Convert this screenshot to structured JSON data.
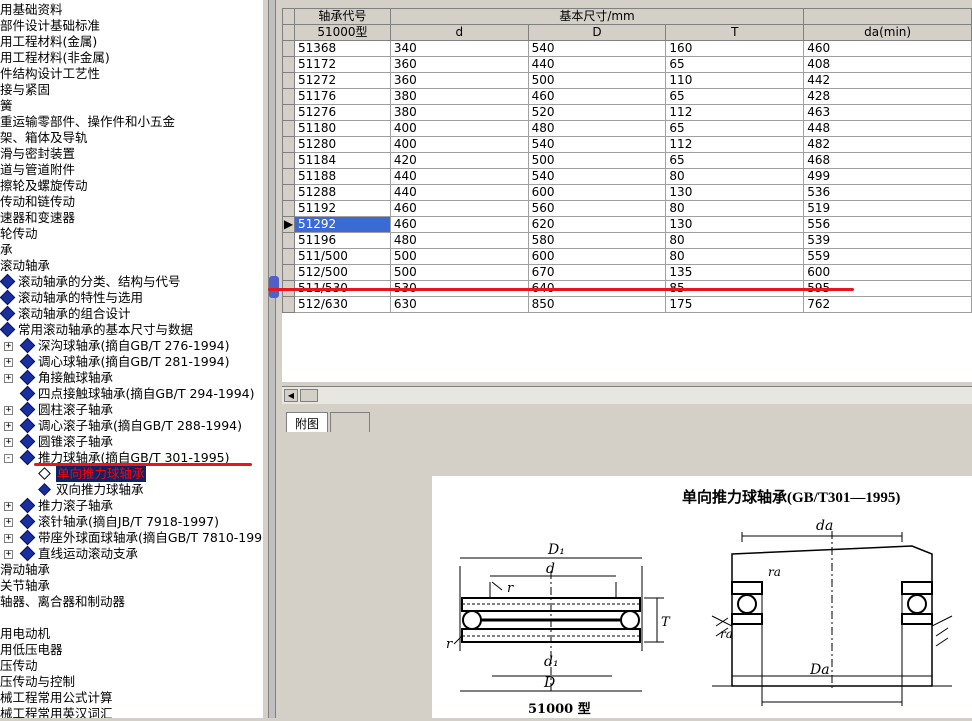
{
  "tree": {
    "items": [
      {
        "label": "用基础资料",
        "x": 0,
        "icon": false
      },
      {
        "label": "部件设计基础标准",
        "x": 0,
        "icon": false
      },
      {
        "label": "用工程材料(金属)",
        "x": 0,
        "icon": false
      },
      {
        "label": "用工程材料(非金属)",
        "x": 0,
        "icon": false
      },
      {
        "label": "件结构设计工艺性",
        "x": 0,
        "icon": false
      },
      {
        "label": "接与紧固",
        "x": 0,
        "icon": false
      },
      {
        "label": "簧",
        "x": 0,
        "icon": false
      },
      {
        "label": "重运输零部件、操作件和小五金",
        "x": 0,
        "icon": false
      },
      {
        "label": "架、箱体及导轨",
        "x": 0,
        "icon": false
      },
      {
        "label": "滑与密封装置",
        "x": 0,
        "icon": false
      },
      {
        "label": "道与管道附件",
        "x": 0,
        "icon": false
      },
      {
        "label": "擦轮及螺旋传动",
        "x": 0,
        "icon": false
      },
      {
        "label": "传动和链传动",
        "x": 0,
        "icon": false
      },
      {
        "label": "速器和变速器",
        "x": 0,
        "icon": false
      },
      {
        "label": "轮传动",
        "x": 0,
        "icon": false
      },
      {
        "label": "承",
        "x": 0,
        "icon": false
      },
      {
        "label": "滚动轴承",
        "x": 0,
        "icon": false
      },
      {
        "label": "滚动轴承的分类、结构与代号",
        "x": 0,
        "icon": true
      },
      {
        "label": "滚动轴承的特性与选用",
        "x": 0,
        "icon": true
      },
      {
        "label": "滚动轴承的组合设计",
        "x": 0,
        "icon": true
      },
      {
        "label": "常用滚动轴承的基本尺寸与数据",
        "x": 0,
        "icon": true
      },
      {
        "label": "深沟球轴承(摘自GB/T 276-1994)",
        "x": 1,
        "icon": true,
        "exp": "+"
      },
      {
        "label": "调心球轴承(摘自GB/T 281-1994)",
        "x": 1,
        "icon": true,
        "exp": "+"
      },
      {
        "label": "角接触球轴承",
        "x": 1,
        "icon": true,
        "exp": "+"
      },
      {
        "label": "四点接触球轴承(摘自GB/T 294-1994)",
        "x": 1,
        "icon": true,
        "exp": ""
      },
      {
        "label": "圆柱滚子轴承",
        "x": 1,
        "icon": true,
        "exp": "+"
      },
      {
        "label": "调心滚子轴承(摘自GB/T 288-1994)",
        "x": 1,
        "icon": true,
        "exp": "+"
      },
      {
        "label": "圆锥滚子轴承",
        "x": 1,
        "icon": true,
        "exp": "+"
      },
      {
        "label": "推力球轴承(摘自GB/T 301-1995)",
        "x": 1,
        "icon": true,
        "exp": "-"
      },
      {
        "label": "单向推力球轴承",
        "x": 2,
        "icon": true,
        "open": true,
        "selected": true
      },
      {
        "label": "双向推力球轴承",
        "x": 2,
        "icon": true
      },
      {
        "label": "推力滚子轴承",
        "x": 1,
        "icon": true,
        "exp": "+"
      },
      {
        "label": "滚针轴承(摘自JB/T 7918-1997)",
        "x": 1,
        "icon": true,
        "exp": "+"
      },
      {
        "label": "带座外球面球轴承(摘自GB/T 7810-1995)",
        "x": 1,
        "icon": true,
        "exp": "+"
      },
      {
        "label": "直线运动滚动支承",
        "x": 1,
        "icon": true,
        "exp": "+"
      },
      {
        "label": "滑动轴承",
        "x": 0,
        "icon": false
      },
      {
        "label": "关节轴承",
        "x": 0,
        "icon": false
      },
      {
        "label": "轴器、离合器和制动器",
        "x": 0,
        "icon": false
      },
      {
        "label": "",
        "x": 0,
        "icon": false
      },
      {
        "label": "用电动机",
        "x": 0,
        "icon": false
      },
      {
        "label": "用低压电器",
        "x": 0,
        "icon": false
      },
      {
        "label": "压传动",
        "x": 0,
        "icon": false
      },
      {
        "label": "压传动与控制",
        "x": 0,
        "icon": false
      },
      {
        "label": "械工程常用公式计算",
        "x": 0,
        "icon": false
      },
      {
        "label": "械工程常用英汉词汇",
        "x": 0,
        "icon": false
      }
    ]
  },
  "table": {
    "header_group": "基本尺寸/mm",
    "col_code": "轴承代号",
    "col_type": "51000型",
    "cols": [
      "d",
      "D",
      "T",
      "da(min)"
    ],
    "rows": [
      [
        "51368",
        "340",
        "540",
        "160",
        "460"
      ],
      [
        "51172",
        "360",
        "440",
        "65",
        "408"
      ],
      [
        "51272",
        "360",
        "500",
        "110",
        "442"
      ],
      [
        "51176",
        "380",
        "460",
        "65",
        "428"
      ],
      [
        "51276",
        "380",
        "520",
        "112",
        "463"
      ],
      [
        "51180",
        "400",
        "480",
        "65",
        "448"
      ],
      [
        "51280",
        "400",
        "540",
        "112",
        "482"
      ],
      [
        "51184",
        "420",
        "500",
        "65",
        "468"
      ],
      [
        "51188",
        "440",
        "540",
        "80",
        "499"
      ],
      [
        "51288",
        "440",
        "600",
        "130",
        "536"
      ],
      [
        "51192",
        "460",
        "560",
        "80",
        "519"
      ],
      [
        "51292",
        "460",
        "620",
        "130",
        "556"
      ],
      [
        "51196",
        "480",
        "580",
        "80",
        "539"
      ],
      [
        "511/500",
        "500",
        "600",
        "80",
        "559"
      ],
      [
        "512/500",
        "500",
        "670",
        "135",
        "600"
      ],
      [
        "511/530",
        "530",
        "640",
        "85",
        "595"
      ],
      [
        "512/630",
        "630",
        "850",
        "175",
        "762"
      ]
    ],
    "selected_row": 11
  },
  "tabs": [
    "附图",
    ""
  ],
  "figure": {
    "title": "单向推力球轴承(GB/T301—1995)",
    "caption": "51000 型",
    "labels": {
      "D1": "D₁",
      "d": "d",
      "r": "r",
      "T": "T",
      "d1": "d₁",
      "D": "D",
      "da": "da",
      "ra": "ra",
      "Da": "Da"
    }
  },
  "colors": {
    "selection": "#0a246a",
    "accent": "#3a6ad4",
    "highlight": "#e8141e"
  }
}
